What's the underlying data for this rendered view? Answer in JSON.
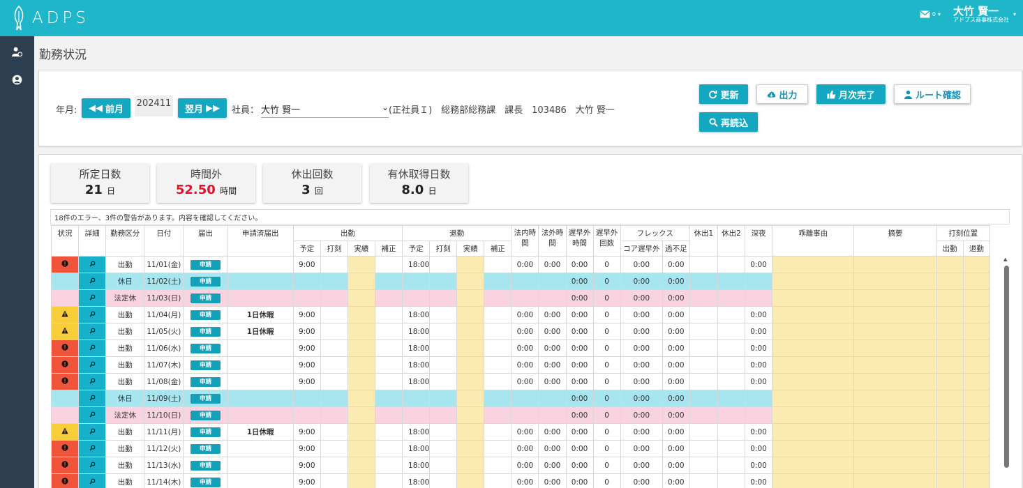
{
  "app": {
    "logo_text": "ADPS"
  },
  "header": {
    "mail_count": "0",
    "user_name": "大竹 賢一",
    "company": "アドプス商事株式会社"
  },
  "page_title": "勤務状況",
  "filter": {
    "year_month_label": "年月:",
    "prev_label": "前月",
    "year_month": "202411",
    "next_label": "翌月",
    "employee_label": "社員：",
    "employee_selected": "大竹 賢一",
    "employee_info": "(正社員Ｉ)　総務部総務課　課長　103486　大竹 賢一"
  },
  "actions": {
    "refresh": "更新",
    "output": "出力",
    "month_complete": "月次完了",
    "route_check": "ルート確認",
    "reload": "再読込"
  },
  "stats": [
    {
      "label": "所定日数",
      "value": "21",
      "unit": "日",
      "color": "#222222"
    },
    {
      "label": "時間外",
      "value": "52.50",
      "unit": "時間",
      "color": "#e3112b"
    },
    {
      "label": "休出回数",
      "value": "3",
      "unit": "回",
      "color": "#222222"
    },
    {
      "label": "有休取得日数",
      "value": "8.0",
      "unit": "日",
      "color": "#222222"
    }
  ],
  "message": "18件のエラー、3件の警告があります。内容を確認してください。",
  "table": {
    "headers": {
      "status": "状況",
      "detail": "詳細",
      "work_type": "勤務区分",
      "date": "日付",
      "request": "届出",
      "applied": "申請済届出",
      "attend": "出勤",
      "leave": "退勤",
      "plan": "予定",
      "stamp": "打刻",
      "actual": "実績",
      "fix": "補正",
      "legal_in": "法内時間",
      "legal_out": "法外時間",
      "late_time": "遅早外時間",
      "late_count": "遅早外回数",
      "flex": "フレックス",
      "core_late": "コア遅早外",
      "over_short": "過不足",
      "holiday1": "休出1",
      "holiday2": "休出2",
      "night": "深夜",
      "deviation": "乖離事由",
      "summary": "摘要",
      "stamp_pos": "打刻位置",
      "pos_in": "出勤",
      "pos_out": "退勤"
    },
    "request_badge": "申請",
    "rows": [
      {
        "status": "error",
        "kind": "work",
        "type": "出勤",
        "date": "11/01(金)",
        "applied": "",
        "start": "9:00",
        "end": "18:00",
        "legal_in": "0:00",
        "legal_out": "0:00",
        "late_time": "0:00",
        "late_count": "0",
        "core": "0:00",
        "over": "0:00",
        "night": "0:00"
      },
      {
        "status": "none",
        "kind": "rest",
        "type": "休日",
        "date": "11/02(土)",
        "applied": "",
        "start": "",
        "end": "",
        "legal_in": "",
        "legal_out": "",
        "late_time": "0:00",
        "late_count": "0",
        "core": "0:00",
        "over": "0:00",
        "night": ""
      },
      {
        "status": "none",
        "kind": "legal",
        "type": "法定休",
        "date": "11/03(日)",
        "applied": "",
        "start": "",
        "end": "",
        "legal_in": "",
        "legal_out": "",
        "late_time": "0:00",
        "late_count": "0",
        "core": "0:00",
        "over": "0:00",
        "night": ""
      },
      {
        "status": "warn",
        "kind": "work",
        "type": "出勤",
        "date": "11/04(月)",
        "applied": "1日休暇",
        "start": "9:00",
        "end": "18:00",
        "legal_in": "0:00",
        "legal_out": "0:00",
        "late_time": "0:00",
        "late_count": "0",
        "core": "0:00",
        "over": "0:00",
        "night": "0:00"
      },
      {
        "status": "warn",
        "kind": "work",
        "type": "出勤",
        "date": "11/05(火)",
        "applied": "1日休暇",
        "start": "9:00",
        "end": "18:00",
        "legal_in": "0:00",
        "legal_out": "0:00",
        "late_time": "0:00",
        "late_count": "0",
        "core": "0:00",
        "over": "0:00",
        "night": "0:00"
      },
      {
        "status": "error",
        "kind": "work",
        "type": "出勤",
        "date": "11/06(水)",
        "applied": "",
        "start": "9:00",
        "end": "18:00",
        "legal_in": "0:00",
        "legal_out": "0:00",
        "late_time": "0:00",
        "late_count": "0",
        "core": "0:00",
        "over": "0:00",
        "night": "0:00"
      },
      {
        "status": "error",
        "kind": "work",
        "type": "出勤",
        "date": "11/07(木)",
        "applied": "",
        "start": "9:00",
        "end": "18:00",
        "legal_in": "0:00",
        "legal_out": "0:00",
        "late_time": "0:00",
        "late_count": "0",
        "core": "0:00",
        "over": "0:00",
        "night": "0:00"
      },
      {
        "status": "error",
        "kind": "work",
        "type": "出勤",
        "date": "11/08(金)",
        "applied": "",
        "start": "9:00",
        "end": "18:00",
        "legal_in": "0:00",
        "legal_out": "0:00",
        "late_time": "0:00",
        "late_count": "0",
        "core": "0:00",
        "over": "0:00",
        "night": "0:00"
      },
      {
        "status": "none",
        "kind": "rest",
        "type": "休日",
        "date": "11/09(土)",
        "applied": "",
        "start": "",
        "end": "",
        "legal_in": "",
        "legal_out": "",
        "late_time": "0:00",
        "late_count": "0",
        "core": "0:00",
        "over": "0:00",
        "night": ""
      },
      {
        "status": "none",
        "kind": "legal",
        "type": "法定休",
        "date": "11/10(日)",
        "applied": "",
        "start": "",
        "end": "",
        "legal_in": "",
        "legal_out": "",
        "late_time": "0:00",
        "late_count": "0",
        "core": "0:00",
        "over": "0:00",
        "night": ""
      },
      {
        "status": "warn",
        "kind": "work",
        "type": "出勤",
        "date": "11/11(月)",
        "applied": "1日休暇",
        "start": "9:00",
        "end": "18:00",
        "legal_in": "0:00",
        "legal_out": "0:00",
        "late_time": "0:00",
        "late_count": "0",
        "core": "0:00",
        "over": "0:00",
        "night": "0:00"
      },
      {
        "status": "error",
        "kind": "work",
        "type": "出勤",
        "date": "11/12(火)",
        "applied": "",
        "start": "9:00",
        "end": "18:00",
        "legal_in": "0:00",
        "legal_out": "0:00",
        "late_time": "0:00",
        "late_count": "0",
        "core": "0:00",
        "over": "0:00",
        "night": "0:00"
      },
      {
        "status": "error",
        "kind": "work",
        "type": "出勤",
        "date": "11/13(水)",
        "applied": "",
        "start": "9:00",
        "end": "18:00",
        "legal_in": "0:00",
        "legal_out": "0:00",
        "late_time": "0:00",
        "late_count": "0",
        "core": "0:00",
        "over": "0:00",
        "night": "0:00"
      },
      {
        "status": "error",
        "kind": "work",
        "type": "出勤",
        "date": "11/14(木)",
        "applied": "",
        "start": "9:00",
        "end": "18:00",
        "legal_in": "0:00",
        "legal_out": "0:00",
        "late_time": "0:00",
        "late_count": "0",
        "core": "0:00",
        "over": "0:00",
        "night": "0:00"
      }
    ]
  },
  "colors": {
    "brand": "#1fb6c9",
    "button": "#14a7c2",
    "sidebar": "#2d3e50",
    "error": "#f0543a",
    "warning": "#f7cd3a",
    "rest_row": "#a8e6ef",
    "legal_row": "#fad3e1",
    "input_cell": "#fbebb0"
  }
}
